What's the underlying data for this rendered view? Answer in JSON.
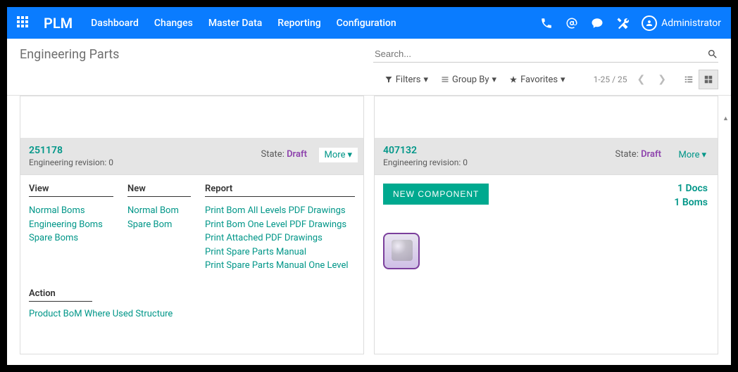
{
  "brand": "PLM",
  "nav": [
    "Dashboard",
    "Changes",
    "Master Data",
    "Reporting",
    "Configuration"
  ],
  "user": "Administrator",
  "page_title": "Engineering Parts",
  "search_placeholder": "Search...",
  "filters": {
    "filters": "Filters",
    "groupby": "Group By",
    "favorites": "Favorites"
  },
  "pager": "1-25 / 25",
  "state_label": "State:",
  "more_label": "More",
  "left_card": {
    "id": "251178",
    "rev": "Engineering revision: 0",
    "state": "Draft",
    "view_h": "View",
    "view_links": [
      "Normal Boms",
      "Engineering Boms",
      "Spare Boms"
    ],
    "new_h": "New",
    "new_links": [
      "Normal Bom",
      "Spare Bom"
    ],
    "report_h": "Report",
    "report_links": [
      "Print Bom All Levels PDF Drawings",
      "Print Bom One Level PDF Drawings",
      "Print Attached PDF Drawings",
      "Print Spare Parts Manual",
      "Print Spare Parts Manual One Level"
    ],
    "action_h": "Action",
    "action_link": "Product BoM Where Used Structure"
  },
  "right_card": {
    "id": "407132",
    "rev": "Engineering revision: 0",
    "state": "Draft",
    "new_component": "NEW COMPONENT",
    "docs": "1 Docs",
    "boms": "1 Boms"
  }
}
